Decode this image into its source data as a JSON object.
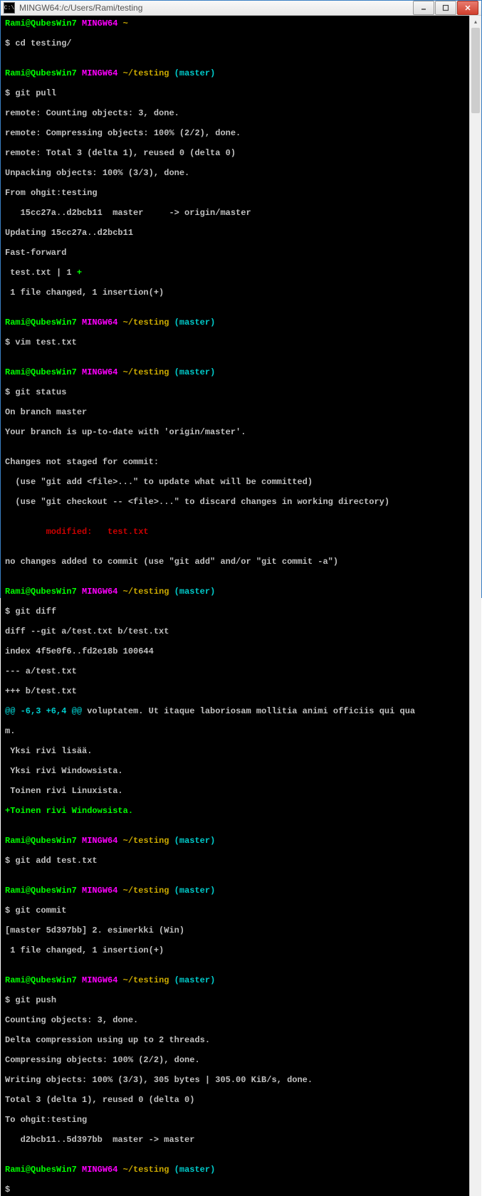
{
  "window": {
    "title": "MINGW64:/c/Users/Rami/testing",
    "icon_label": "C:\\"
  },
  "prompt": {
    "user": "Rami@QubesWin7",
    "shell": "MINGW64",
    "home": "~",
    "cwd": "~/testing",
    "branch": "(master)",
    "symbol": "$"
  },
  "session": {
    "cmd_cd": "cd testing/",
    "cmd_pull": "git pull",
    "pull_l1": "remote: Counting objects: 3, done.",
    "pull_l2": "remote: Compressing objects: 100% (2/2), done.",
    "pull_l3": "remote: Total 3 (delta 1), reused 0 (delta 0)",
    "pull_l4": "Unpacking objects: 100% (3/3), done.",
    "pull_l5": "From ohgit:testing",
    "pull_l6": "   15cc27a..d2bcb11  master     -> origin/master",
    "pull_l7": "Updating 15cc27a..d2bcb11",
    "pull_l8": "Fast-forward",
    "pull_l9a": " test.txt | 1 ",
    "pull_l9b": "+",
    "pull_l10": " 1 file changed, 1 insertion(+)",
    "cmd_vim": "vim test.txt",
    "cmd_status": "git status",
    "status_l1": "On branch master",
    "status_l2": "Your branch is up-to-date with 'origin/master'.",
    "status_l3": "Changes not staged for commit:",
    "status_l4": "  (use \"git add <file>...\" to update what will be committed)",
    "status_l5": "  (use \"git checkout -- <file>...\" to discard changes in working directory)",
    "status_mod": "        modified:   test.txt",
    "status_l6": "no changes added to commit (use \"git add\" and/or \"git commit -a\")",
    "cmd_diff": "git diff",
    "diff_l1": "diff --git a/test.txt b/test.txt",
    "diff_l2": "index 4f5e0f6..fd2e18b 100644",
    "diff_l3": "--- a/test.txt",
    "diff_l4": "+++ b/test.txt",
    "diff_hunk1": "@@ -6,3 +6,4 @@",
    "diff_hunk2": " voluptatem. Ut itaque laboriosam mollitia animi officiis qui qua",
    "diff_hunk3": "m.",
    "diff_c1": " Yksi rivi lisää.",
    "diff_c2": " Yksi rivi Windowsista.",
    "diff_c3": " Toinen rivi Linuxista.",
    "diff_add": "+Toinen rivi Windowsista.",
    "cmd_add": "git add test.txt",
    "cmd_commit": "git commit",
    "commit_l1": "[master 5d397bb] 2. esimerkki (Win)",
    "commit_l2": " 1 file changed, 1 insertion(+)",
    "cmd_push": "git push",
    "push_l1": "Counting objects: 3, done.",
    "push_l2": "Delta compression using up to 2 threads.",
    "push_l3": "Compressing objects: 100% (2/2), done.",
    "push_l4": "Writing objects: 100% (3/3), 305 bytes | 305.00 KiB/s, done.",
    "push_l5": "Total 3 (delta 1), reused 0 (delta 0)",
    "push_l6": "To ohgit:testing",
    "push_l7": "   d2bcb11..5d397bb  master -> master"
  }
}
